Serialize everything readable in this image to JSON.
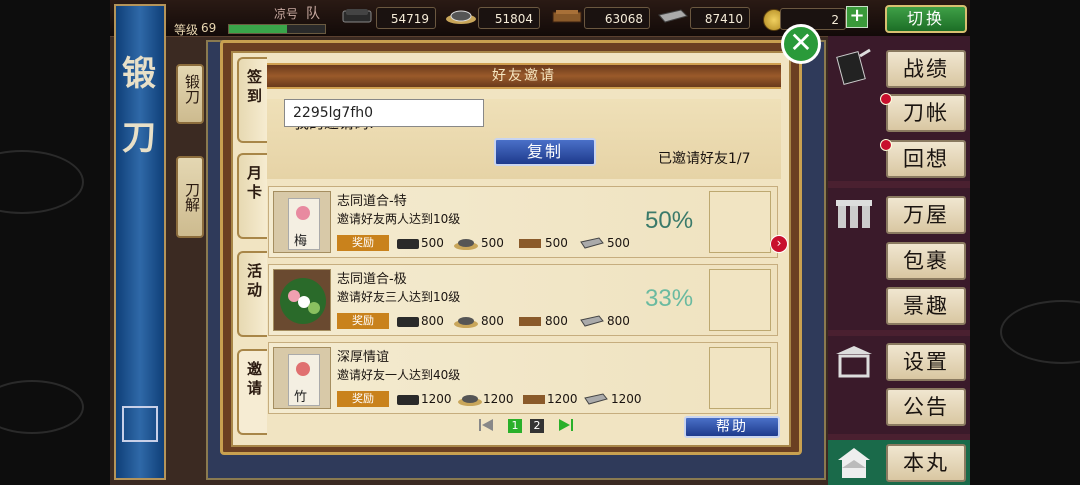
{
  "top_bar": {
    "level_label": "等级",
    "level_value": "69",
    "team_label": "凉号",
    "team_suffix": "队",
    "resources": [
      {
        "name": "charcoal",
        "value": "54719"
      },
      {
        "name": "jade-steel",
        "value": "51804"
      },
      {
        "name": "cooling-material",
        "value": "63068"
      },
      {
        "name": "whetstone",
        "value": "87410"
      }
    ],
    "coin_value": "2",
    "switch_label": "切换"
  },
  "left_banner": {
    "chars": [
      "锻",
      "刀"
    ]
  },
  "behind_tabs": {
    "forge": "锻刀",
    "dismantle": "刀解"
  },
  "right_menu": {
    "items": [
      {
        "label": "战绩",
        "dot": false
      },
      {
        "label": "刀帐",
        "dot": true
      },
      {
        "label": "回想",
        "dot": true
      },
      {
        "label": "万屋",
        "dot": false
      },
      {
        "label": "包裹",
        "dot": false
      },
      {
        "label": "景趣",
        "dot": false
      },
      {
        "label": "设置",
        "dot": false
      },
      {
        "label": "公告",
        "dot": false
      },
      {
        "label": "本丸",
        "dot": false
      }
    ]
  },
  "modal": {
    "title": "好友邀请",
    "side_tabs": [
      "签到",
      "月卡",
      "活动",
      "邀请"
    ],
    "my_code_label": "我的邀请码:",
    "code_value": "2295lg7fh0",
    "copy_label": "复制",
    "invited_status": "已邀请好友1/7",
    "tasks": [
      {
        "title": "志同道合-特",
        "desc": "邀请好友两人达到10级",
        "reward_label": "奖励",
        "rewards": [
          "500",
          "500",
          "500",
          "500"
        ],
        "percent": "50%",
        "icon_char": "梅"
      },
      {
        "title": "志同道合-极",
        "desc": "邀请好友三人达到10级",
        "reward_label": "奖励",
        "rewards": [
          "800",
          "800",
          "800",
          "800"
        ],
        "percent": "33%",
        "icon_char": ""
      },
      {
        "title": "深厚情谊",
        "desc": "邀请好友一人达到40级",
        "reward_label": "奖励",
        "rewards": [
          "1200",
          "1200",
          "1200",
          "1200"
        ],
        "percent": "",
        "icon_char": "竹"
      }
    ],
    "pagination": {
      "pages": [
        "1",
        "2"
      ],
      "current": "1"
    },
    "help_label": "帮助"
  },
  "colors": {
    "accent_green": "#2a9a3a",
    "accent_blue": "#1e3a8c",
    "percent_dark": "#3a7a6a",
    "percent_light": "#6abaa0",
    "reward_orange": "#c9821c"
  }
}
